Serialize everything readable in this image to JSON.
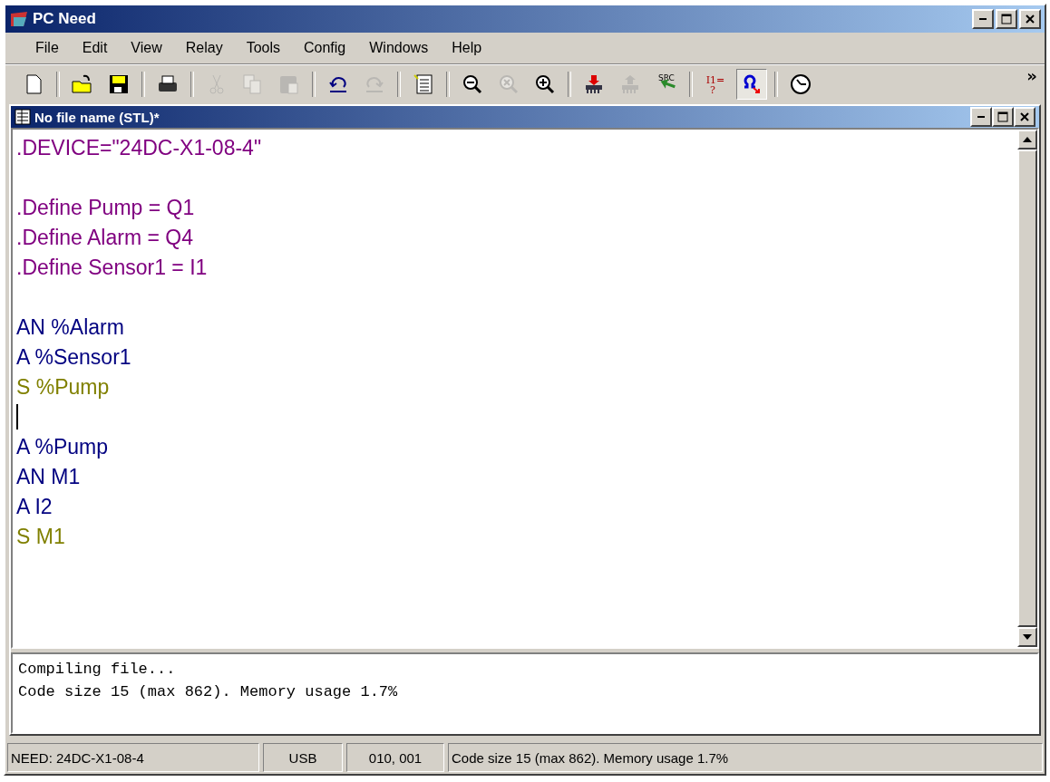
{
  "window": {
    "title": "PC Need"
  },
  "menu": [
    "File",
    "Edit",
    "View",
    "Relay",
    "Tools",
    "Config",
    "Windows",
    "Help"
  ],
  "toolbar": {
    "groups": [
      [
        {
          "kind": "new",
          "disabled": false,
          "selected": false
        }
      ],
      [
        {
          "kind": "open",
          "disabled": false,
          "selected": false
        },
        {
          "kind": "save",
          "disabled": false,
          "selected": false
        }
      ],
      [
        {
          "kind": "print",
          "disabled": false,
          "selected": false
        }
      ],
      [
        {
          "kind": "cut",
          "disabled": true,
          "selected": false
        },
        {
          "kind": "copy",
          "disabled": true,
          "selected": false
        },
        {
          "kind": "paste",
          "disabled": true,
          "selected": false
        }
      ],
      [
        {
          "kind": "undo",
          "disabled": false,
          "selected": false
        },
        {
          "kind": "redo",
          "disabled": true,
          "selected": false
        }
      ],
      [
        {
          "kind": "binary",
          "disabled": false,
          "selected": false
        }
      ],
      [
        {
          "kind": "zoom-out",
          "disabled": false,
          "selected": false
        },
        {
          "kind": "zoom-reset",
          "disabled": true,
          "selected": false
        },
        {
          "kind": "zoom-in",
          "disabled": false,
          "selected": false
        }
      ],
      [
        {
          "kind": "download",
          "disabled": false,
          "selected": false
        },
        {
          "kind": "upload",
          "disabled": true,
          "selected": false
        },
        {
          "kind": "source",
          "glyph": "SRC",
          "disabled": false,
          "selected": false
        }
      ],
      [
        {
          "kind": "io",
          "glyph": "I1=",
          "glyph2": "?",
          "disabled": false,
          "selected": false
        },
        {
          "kind": "online",
          "disabled": false,
          "selected": true
        }
      ],
      [
        {
          "kind": "clock",
          "disabled": false,
          "selected": false
        }
      ]
    ],
    "overflow": "»"
  },
  "document": {
    "title": "No file name (STL)*",
    "lines": [
      {
        "kind": "directive",
        "text": ".DEVICE=\"24DC-X1-08-4\""
      },
      {
        "kind": "blank"
      },
      {
        "kind": "directive",
        "text": ".Define Pump = Q1"
      },
      {
        "kind": "directive",
        "text": ".Define Alarm = Q4"
      },
      {
        "kind": "directive",
        "text": ".Define Sensor1 = I1"
      },
      {
        "kind": "blank"
      },
      {
        "kind": "instruction",
        "text": "AN %Alarm"
      },
      {
        "kind": "instruction",
        "text": "A %Sensor1"
      },
      {
        "kind": "set",
        "text": "S %Pump"
      },
      {
        "kind": "cursor"
      },
      {
        "kind": "instruction",
        "text": "A %Pump"
      },
      {
        "kind": "instruction",
        "text": "AN M1"
      },
      {
        "kind": "instruction",
        "text": "A I2"
      },
      {
        "kind": "set",
        "text": "S M1"
      }
    ]
  },
  "output": [
    "Compiling file...",
    "Code size 15 (max 862). Memory usage 1.7%"
  ],
  "status_bar": [
    "NEED: 24DC-X1-08-4",
    "USB",
    "010, 001",
    "Code size 15 (max 862). Memory usage 1.7%"
  ]
}
